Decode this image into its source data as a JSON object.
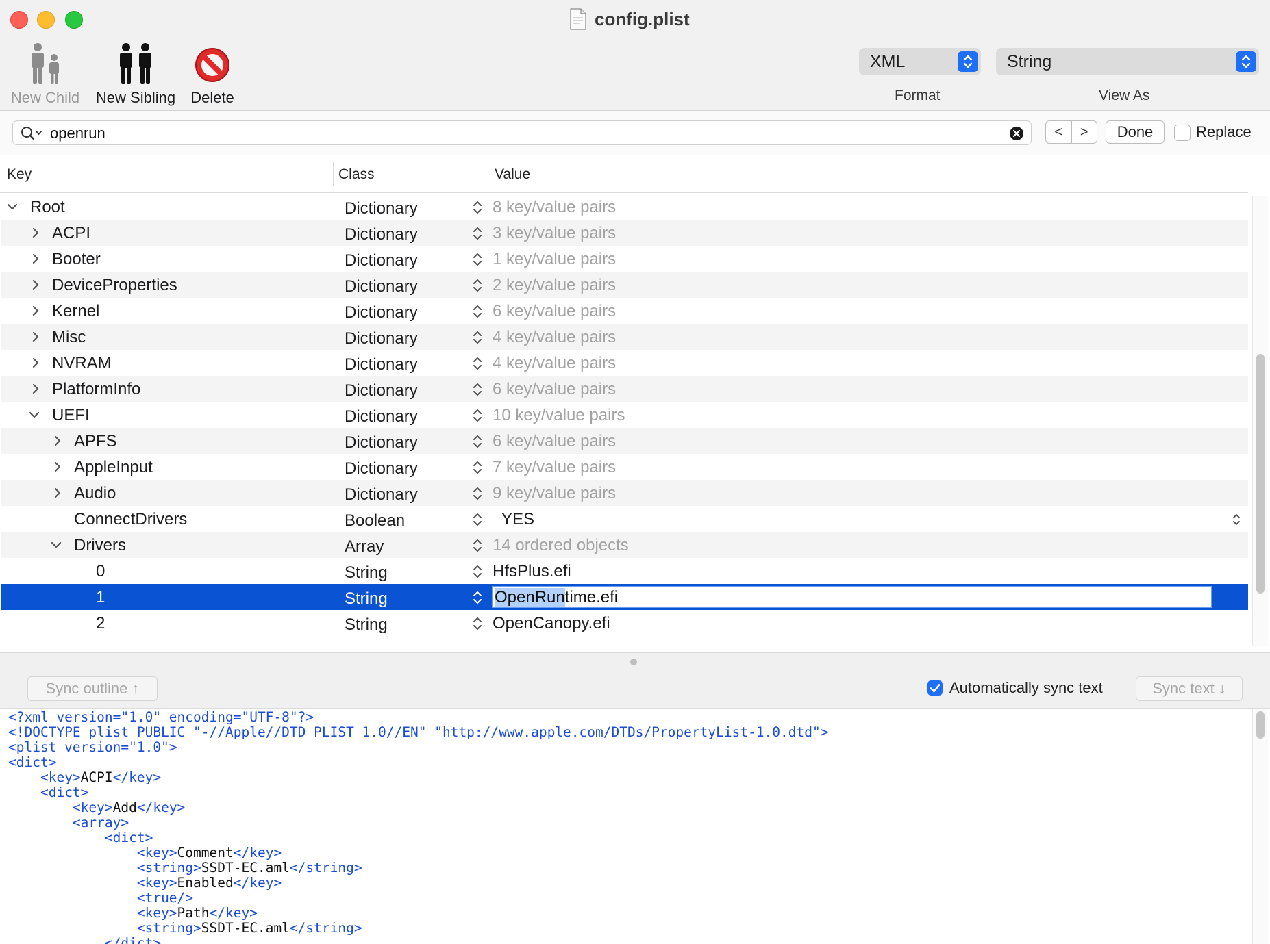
{
  "window": {
    "title": "config.plist"
  },
  "toolbar": {
    "new_child_label": "New Child",
    "new_sibling_label": "New Sibling",
    "delete_label": "Delete",
    "format_value": "XML",
    "format_caption": "Format",
    "viewas_value": "String",
    "viewas_caption": "View As"
  },
  "find": {
    "query": "openrun",
    "prev_label": "<",
    "next_label": ">",
    "done_label": "Done",
    "replace_label": "Replace"
  },
  "outline": {
    "columns": {
      "key": "Key",
      "class": "Class",
      "value": "Value"
    },
    "rows": [
      {
        "key": "Root",
        "class": "Dictionary",
        "value": "8 key/value pairs"
      },
      {
        "key": "ACPI",
        "class": "Dictionary",
        "value": "3 key/value pairs"
      },
      {
        "key": "Booter",
        "class": "Dictionary",
        "value": "1 key/value pairs"
      },
      {
        "key": "DeviceProperties",
        "class": "Dictionary",
        "value": "2 key/value pairs"
      },
      {
        "key": "Kernel",
        "class": "Dictionary",
        "value": "6 key/value pairs"
      },
      {
        "key": "Misc",
        "class": "Dictionary",
        "value": "4 key/value pairs"
      },
      {
        "key": "NVRAM",
        "class": "Dictionary",
        "value": "4 key/value pairs"
      },
      {
        "key": "PlatformInfo",
        "class": "Dictionary",
        "value": "6 key/value pairs"
      },
      {
        "key": "UEFI",
        "class": "Dictionary",
        "value": "10 key/value pairs"
      },
      {
        "key": "APFS",
        "class": "Dictionary",
        "value": "6 key/value pairs"
      },
      {
        "key": "AppleInput",
        "class": "Dictionary",
        "value": "7 key/value pairs"
      },
      {
        "key": "Audio",
        "class": "Dictionary",
        "value": "9 key/value pairs"
      },
      {
        "key": "ConnectDrivers",
        "class": "Boolean",
        "value": "YES"
      },
      {
        "key": "Drivers",
        "class": "Array",
        "value": "14 ordered objects"
      },
      {
        "key": "0",
        "class": "String",
        "value": "HfsPlus.efi"
      },
      {
        "key": "1",
        "class": "String",
        "value_match": "OpenRun",
        "value_rest": "time.efi"
      },
      {
        "key": "2",
        "class": "String",
        "value": "OpenCanopy.efi"
      }
    ]
  },
  "sync": {
    "sync_outline_label": "Sync outline ↑",
    "auto_sync_label": "Automatically sync text",
    "sync_text_label": "Sync text ↓"
  },
  "text": {
    "lines": [
      "<?xml version=\"1.0\" encoding=\"UTF-8\"?>",
      "<!DOCTYPE plist PUBLIC \"-//Apple//DTD PLIST 1.0//EN\" \"http://www.apple.com/DTDs/PropertyList-1.0.dtd\">",
      "<plist version=\"1.0\">",
      "<dict>",
      "    <key>ACPI</key>",
      "    <dict>",
      "        <key>Add</key>",
      "        <array>",
      "            <dict>",
      "                <key>Comment</key>",
      "                <string>SSDT-EC.aml</string>",
      "                <key>Enabled</key>",
      "                <true/>",
      "                <key>Path</key>",
      "                <string>SSDT-EC.aml</string>",
      "            </dict>"
    ]
  },
  "colors": {
    "selection": "#0a53d2",
    "accent": "#1f6ff6",
    "tag": "#1a4cd6",
    "muted": "#a3a3a3"
  }
}
